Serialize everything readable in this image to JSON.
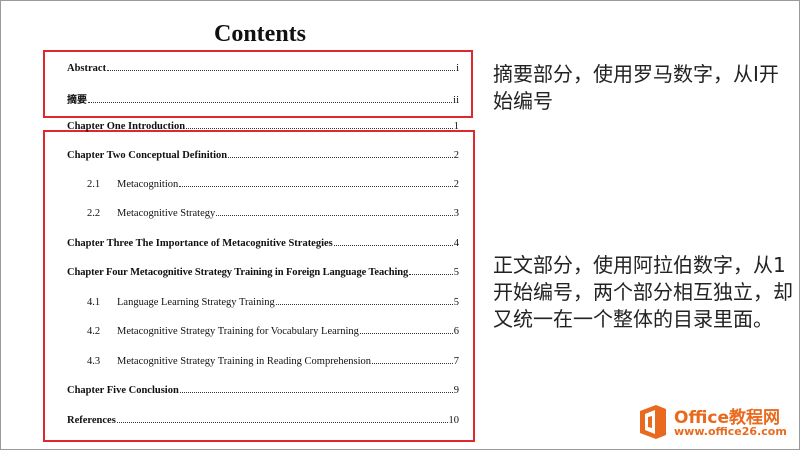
{
  "title": "Contents",
  "front_matter": [
    {
      "text": "Abstract",
      "page": "i",
      "bold": true
    },
    {
      "text": "摘要",
      "page": "ii",
      "bold": true
    }
  ],
  "body_entries": [
    {
      "num": "",
      "text": "Chapter One Introduction",
      "page": "1",
      "bold": true
    },
    {
      "num": "",
      "text": "Chapter Two Conceptual Definition",
      "page": "2",
      "bold": true
    },
    {
      "num": "2.1",
      "text": "Metacognition",
      "page": "2",
      "bold": false
    },
    {
      "num": "2.2",
      "text": "Metacognitive Strategy",
      "page": "3",
      "bold": false
    },
    {
      "num": "",
      "text": "Chapter Three The Importance of Metacognitive Strategies",
      "page": "4",
      "bold": true
    },
    {
      "num": "",
      "text": "Chapter Four Metacognitive Strategy Training in Foreign Language Teaching",
      "page": "5",
      "bold": true
    },
    {
      "num": "4.1",
      "text": "Language Learning Strategy Training",
      "page": "5",
      "bold": false
    },
    {
      "num": "4.2",
      "text": "Metacognitive Strategy Training for Vocabulary Learning",
      "page": "6",
      "bold": false
    },
    {
      "num": "4.3",
      "text": "Metacognitive Strategy Training in Reading Comprehension",
      "page": "7",
      "bold": false
    },
    {
      "num": "",
      "text": "Chapter Five Conclusion",
      "page": "9",
      "bold": true
    },
    {
      "num": "",
      "text": "References",
      "page": "10",
      "bold": true
    }
  ],
  "notes": {
    "front": "摘要部分，使用罗马数字，从Ⅰ开始编号",
    "body": "正文部分，使用阿拉伯数字，从1开始编号，两个部分相互独立，却又统一在一个整体的目录里面。"
  },
  "logo": {
    "title": "Office教程网",
    "url": "www.office26.com",
    "icon": "office-logo-icon"
  },
  "colors": {
    "highlight": "#e0272b",
    "logo": "#e96a1e"
  }
}
